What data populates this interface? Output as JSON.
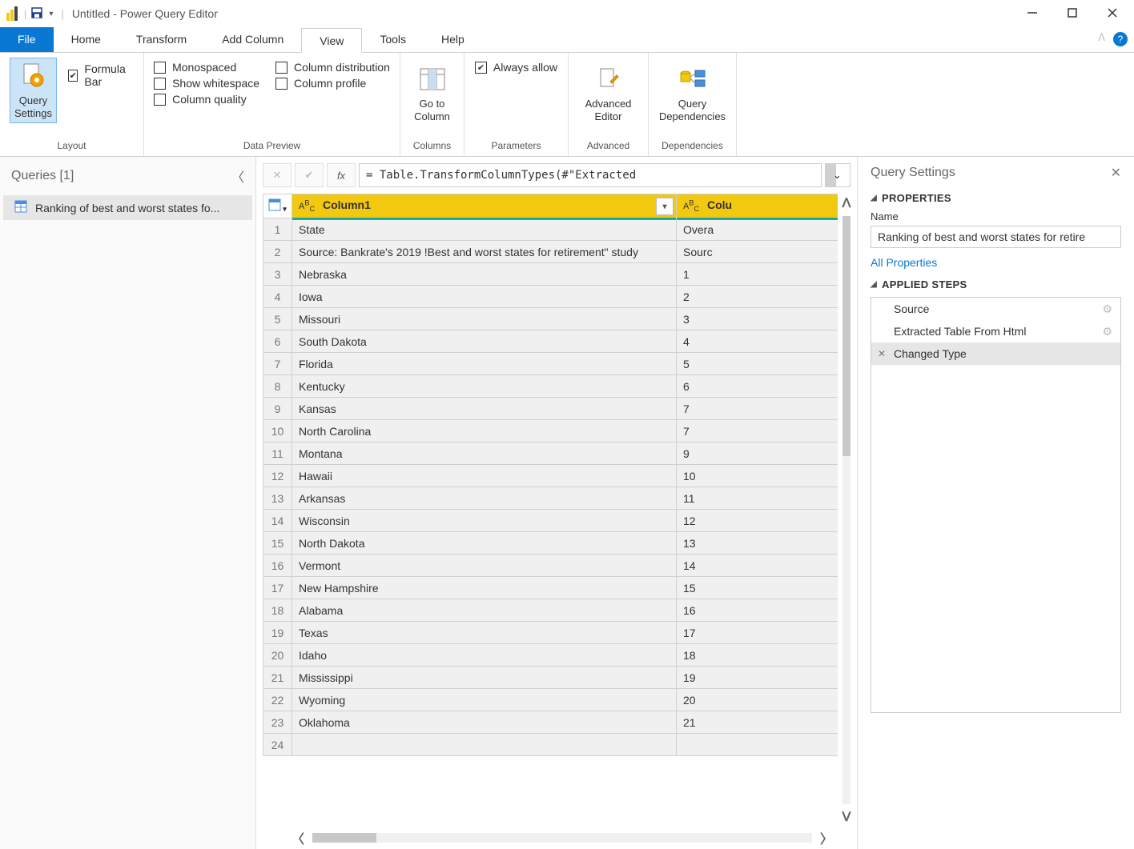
{
  "titlebar": {
    "title": "Untitled - Power Query Editor"
  },
  "menu": {
    "items": [
      "File",
      "Home",
      "Transform",
      "Add Column",
      "View",
      "Tools",
      "Help"
    ],
    "active": "View"
  },
  "ribbon": {
    "layout": {
      "group_label": "Layout",
      "query_settings": "Query\nSettings",
      "formula_bar": "Formula Bar"
    },
    "data_preview": {
      "group_label": "Data Preview",
      "monospaced": "Monospaced",
      "show_whitespace": "Show whitespace",
      "column_quality": "Column quality",
      "column_distribution": "Column distribution",
      "column_profile": "Column profile"
    },
    "columns": {
      "group_label": "Columns",
      "go_to_column": "Go to\nColumn"
    },
    "parameters": {
      "group_label": "Parameters",
      "always_allow": "Always allow"
    },
    "advanced": {
      "group_label": "Advanced",
      "advanced_editor": "Advanced\nEditor"
    },
    "dependencies": {
      "group_label": "Dependencies",
      "query_dependencies": "Query\nDependencies"
    }
  },
  "queries": {
    "header": "Queries [1]",
    "items": [
      "Ranking of best and worst states fo..."
    ]
  },
  "formula": {
    "fx": "fx",
    "text": "= Table.TransformColumnTypes(#\"Extracted"
  },
  "grid": {
    "columns": [
      {
        "type_badge": "ABC",
        "name": "Column1"
      },
      {
        "type_badge": "ABC",
        "name": "Colu"
      }
    ],
    "rows": [
      {
        "n": 1,
        "c1": "State",
        "c2": "Overa"
      },
      {
        "n": 2,
        "c1": "Source: Bankrate's 2019 !Best and worst states for retirement\" study",
        "c2": "Sourc"
      },
      {
        "n": 3,
        "c1": "Nebraska",
        "c2": "1"
      },
      {
        "n": 4,
        "c1": "Iowa",
        "c2": "2"
      },
      {
        "n": 5,
        "c1": "Missouri",
        "c2": "3"
      },
      {
        "n": 6,
        "c1": "South Dakota",
        "c2": "4"
      },
      {
        "n": 7,
        "c1": "Florida",
        "c2": "5"
      },
      {
        "n": 8,
        "c1": "Kentucky",
        "c2": "6"
      },
      {
        "n": 9,
        "c1": "Kansas",
        "c2": "7"
      },
      {
        "n": 10,
        "c1": "North Carolina",
        "c2": "7"
      },
      {
        "n": 11,
        "c1": "Montana",
        "c2": "9"
      },
      {
        "n": 12,
        "c1": "Hawaii",
        "c2": "10"
      },
      {
        "n": 13,
        "c1": "Arkansas",
        "c2": "11"
      },
      {
        "n": 14,
        "c1": "Wisconsin",
        "c2": "12"
      },
      {
        "n": 15,
        "c1": "North Dakota",
        "c2": "13"
      },
      {
        "n": 16,
        "c1": "Vermont",
        "c2": "14"
      },
      {
        "n": 17,
        "c1": "New Hampshire",
        "c2": "15"
      },
      {
        "n": 18,
        "c1": "Alabama",
        "c2": "16"
      },
      {
        "n": 19,
        "c1": "Texas",
        "c2": "17"
      },
      {
        "n": 20,
        "c1": "Idaho",
        "c2": "18"
      },
      {
        "n": 21,
        "c1": "Mississippi",
        "c2": "19"
      },
      {
        "n": 22,
        "c1": "Wyoming",
        "c2": "20"
      },
      {
        "n": 23,
        "c1": "Oklahoma",
        "c2": "21"
      },
      {
        "n": 24,
        "c1": "",
        "c2": ""
      }
    ]
  },
  "settings": {
    "header": "Query Settings",
    "properties_heading": "PROPERTIES",
    "name_label": "Name",
    "name_value": "Ranking of best and worst states for retire",
    "all_properties": "All Properties",
    "applied_steps_heading": "APPLIED STEPS",
    "steps": [
      {
        "label": "Source",
        "gear": true,
        "selected": false,
        "removable": false
      },
      {
        "label": "Extracted Table From Html",
        "gear": true,
        "selected": false,
        "removable": false
      },
      {
        "label": "Changed Type",
        "gear": false,
        "selected": true,
        "removable": true
      }
    ]
  }
}
